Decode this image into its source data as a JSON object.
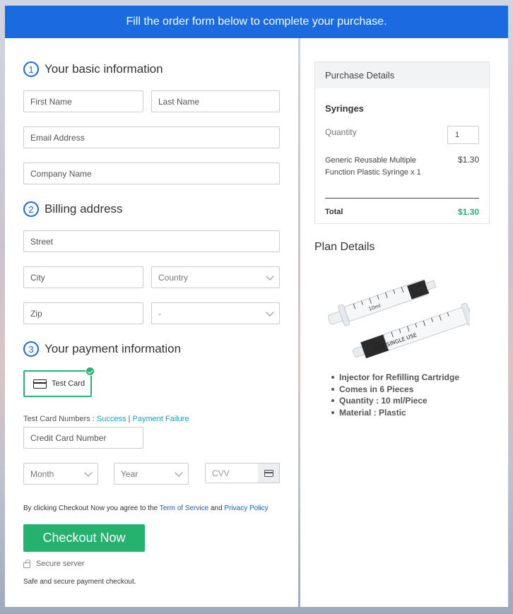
{
  "banner": {
    "text": "Fill the order form below to complete your purchase."
  },
  "sections": {
    "basic": {
      "number": "1",
      "title": "Your basic information"
    },
    "billing": {
      "number": "2",
      "title": "Billing address"
    },
    "payment": {
      "number": "3",
      "title": "Your payment information"
    }
  },
  "fields": {
    "first_name": "First Name",
    "last_name": "Last Name",
    "email": "Email Address",
    "company": "Company Name",
    "street": "Street",
    "city": "City",
    "country": "Country",
    "zip": "Zip",
    "state": "-",
    "card_number": "Credit Card Number",
    "month": "Month",
    "year": "Year",
    "cvv": "CVV"
  },
  "payment": {
    "card_option": "Test Card",
    "test_numbers_label": "Test Card Numbers : ",
    "success_link": "Success",
    "separator": " | ",
    "failure_link": "Payment Failure"
  },
  "terms": {
    "prefix": "By clicking Checkout Now you agree to the ",
    "terms_link": "Term of Service",
    "and": " and ",
    "privacy_link": "Privacy Policy"
  },
  "checkout": {
    "button": "Checkout Now",
    "secure": "Secure server",
    "safe_text": "Safe and secure payment checkout."
  },
  "purchase_details": {
    "header": "Purchase Details",
    "product": "Syringes",
    "quantity_label": "Quantity",
    "quantity_value": "1",
    "item_desc": "Generic Reusable Multiple Function Plastic Syringe x 1",
    "item_price": "$1.30",
    "total_label": "Total",
    "total_value": "$1.30"
  },
  "plan": {
    "title": "Plan Details",
    "image_text_1": "10ml",
    "image_text_2": "FOR SINGLE USE",
    "features": [
      "Injector for Refilling Cartridge",
      "Comes in 6 Pieces",
      "Quantity : 10 ml/Piece",
      "Material : Plastic"
    ]
  },
  "colors": {
    "accent": "#1a6be0",
    "success": "#26b473",
    "link": "#1aa3c8"
  }
}
